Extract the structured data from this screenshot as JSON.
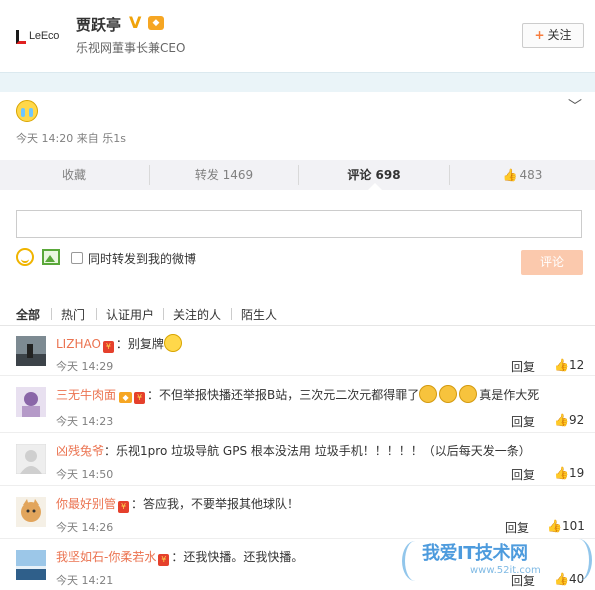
{
  "profile": {
    "logo_text": "LeEco",
    "name": "贾跃亭",
    "verified_badge": "V",
    "title": "乐视网董事长兼CEO",
    "follow_label": "关注",
    "follow_icon": "+"
  },
  "post": {
    "meta": "今天 14:20 来自 乐1s",
    "expand_icon": "chevron-down-icon"
  },
  "tabs": {
    "favorite": "收藏",
    "repost": "转发 1469",
    "comment": "评论 698",
    "like": "483"
  },
  "composer": {
    "input_value": "",
    "repost_label": "同时转发到我的微博",
    "submit_label": "评论"
  },
  "filters": [
    "全部",
    "热门",
    "认证用户",
    "关注的人",
    "陌生人"
  ],
  "comments": [
    {
      "user": "LIZHAO",
      "text": "：别复牌",
      "time": "今天 14:29",
      "reply": "回复",
      "likes": "12"
    },
    {
      "user": "三无牛肉面",
      "text": "：不但举报快播还举报B站，三次元二次元都得罪了",
      "text_after": "真是作大死",
      "time": "今天 14:23",
      "reply": "回复",
      "likes": "92"
    },
    {
      "user": "凶残兔爷",
      "text": "：乐视1pro  垃圾导航  GPS 根本没法用  垃圾手机！！！！！（以后每天发一条）",
      "time": "今天 14:50",
      "reply": "回复",
      "likes": "19"
    },
    {
      "user": "你最好别管",
      "text": "：答应我，不要举报其他球队！",
      "time": "今天 14:26",
      "reply": "回复",
      "likes": "101"
    },
    {
      "user": "我坚如石-你柔若水",
      "text": "：还我快播。还我快播。",
      "time": "今天 14:21",
      "reply": "回复",
      "likes": "40"
    }
  ],
  "watermark": {
    "text": "我爱IT技术网",
    "url": "www.52it.com"
  }
}
